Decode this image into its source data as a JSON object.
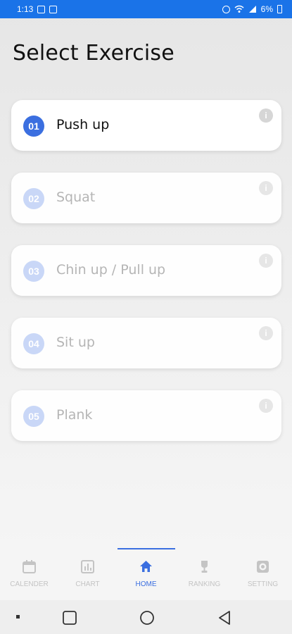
{
  "status_bar": {
    "time": "1:13",
    "battery": "6%"
  },
  "page": {
    "title": "Select Exercise"
  },
  "exercises": [
    {
      "number": "01",
      "name": "Push up",
      "info": "i"
    },
    {
      "number": "02",
      "name": "Squat",
      "info": "i"
    },
    {
      "number": "03",
      "name": "Chin up / Pull up",
      "info": "i"
    },
    {
      "number": "04",
      "name": "Sit up",
      "info": "i"
    },
    {
      "number": "05",
      "name": "Plank",
      "info": "i"
    }
  ],
  "bottom_nav": [
    {
      "label": "CALENDER",
      "icon": "calendar-icon"
    },
    {
      "label": "CHART",
      "icon": "chart-icon"
    },
    {
      "label": "HOME",
      "icon": "home-icon"
    },
    {
      "label": "RANKING",
      "icon": "trophy-icon"
    },
    {
      "label": "SETTING",
      "icon": "gear-icon"
    }
  ],
  "colors": {
    "accent": "#3b6fe0",
    "status_bar": "#1a73e8",
    "inactive": "#c4c4c4"
  }
}
